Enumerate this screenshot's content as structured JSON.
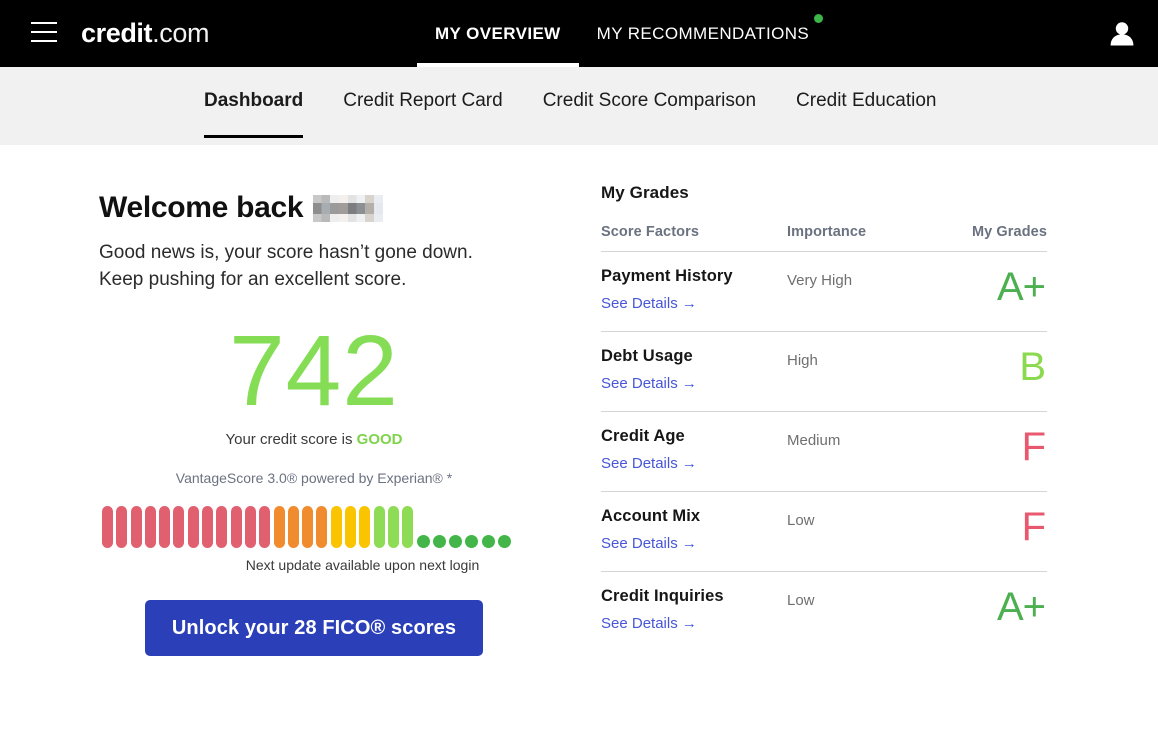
{
  "topnav": {
    "menu_icon": "hamburger-menu-icon",
    "logo_bold": "credit",
    "logo_light": ".com",
    "tabs": [
      {
        "label": "MY OVERVIEW",
        "active": true,
        "badge": false
      },
      {
        "label": "MY RECOMMENDATIONS",
        "active": false,
        "badge": true
      }
    ],
    "badge_color": "#3cb54a",
    "account_icon": "person-avatar-icon"
  },
  "subnav": {
    "tabs": [
      {
        "label": "Dashboard",
        "active": true
      },
      {
        "label": "Credit Report Card",
        "active": false
      },
      {
        "label": "Credit Score Comparison",
        "active": false
      },
      {
        "label": "Credit Education",
        "active": false
      }
    ]
  },
  "overview": {
    "welcome_text": "Welcome back",
    "name_redacted": true,
    "message_line1": "Good news is, your score hasn’t gone down.",
    "message_line2": "Keep pushing for an excellent score.",
    "score": "742",
    "score_color": "#84dd55",
    "score_caption_prefix": "Your credit score is ",
    "score_rating": "GOOD",
    "score_provider": "VantageScore 3.0® powered by Experian® *",
    "next_update": "Next update available upon next login",
    "cta_label": "Unlock your 28 FICO® scores",
    "cta_color": "#2b3fb8"
  },
  "gauge": {
    "segments": [
      {
        "color": "#e06070",
        "count": 12
      },
      {
        "color": "#f08c2e",
        "count": 4
      },
      {
        "color": "#fbc400",
        "count": 3
      },
      {
        "color": "#8edc55",
        "count": 3
      }
    ],
    "dots": {
      "color": "#43b649",
      "count": 6
    }
  },
  "grades": {
    "title": "My Grades",
    "columns": [
      "Score Factors",
      "Importance",
      "My Grades"
    ],
    "details_label": "See Details →",
    "rows": [
      {
        "factor": "Payment History",
        "importance": "Very High",
        "grade": "A+",
        "grade_color": "#4caf50"
      },
      {
        "factor": "Debt Usage",
        "importance": "High",
        "grade": "B",
        "grade_color": "#8bd94f"
      },
      {
        "factor": "Credit Age",
        "importance": "Medium",
        "grade": "F",
        "grade_color": "#e8596f"
      },
      {
        "factor": "Account Mix",
        "importance": "Low",
        "grade": "F",
        "grade_color": "#e8596f"
      },
      {
        "factor": "Credit Inquiries",
        "importance": "Low",
        "grade": "A+",
        "grade_color": "#4caf50"
      }
    ]
  }
}
